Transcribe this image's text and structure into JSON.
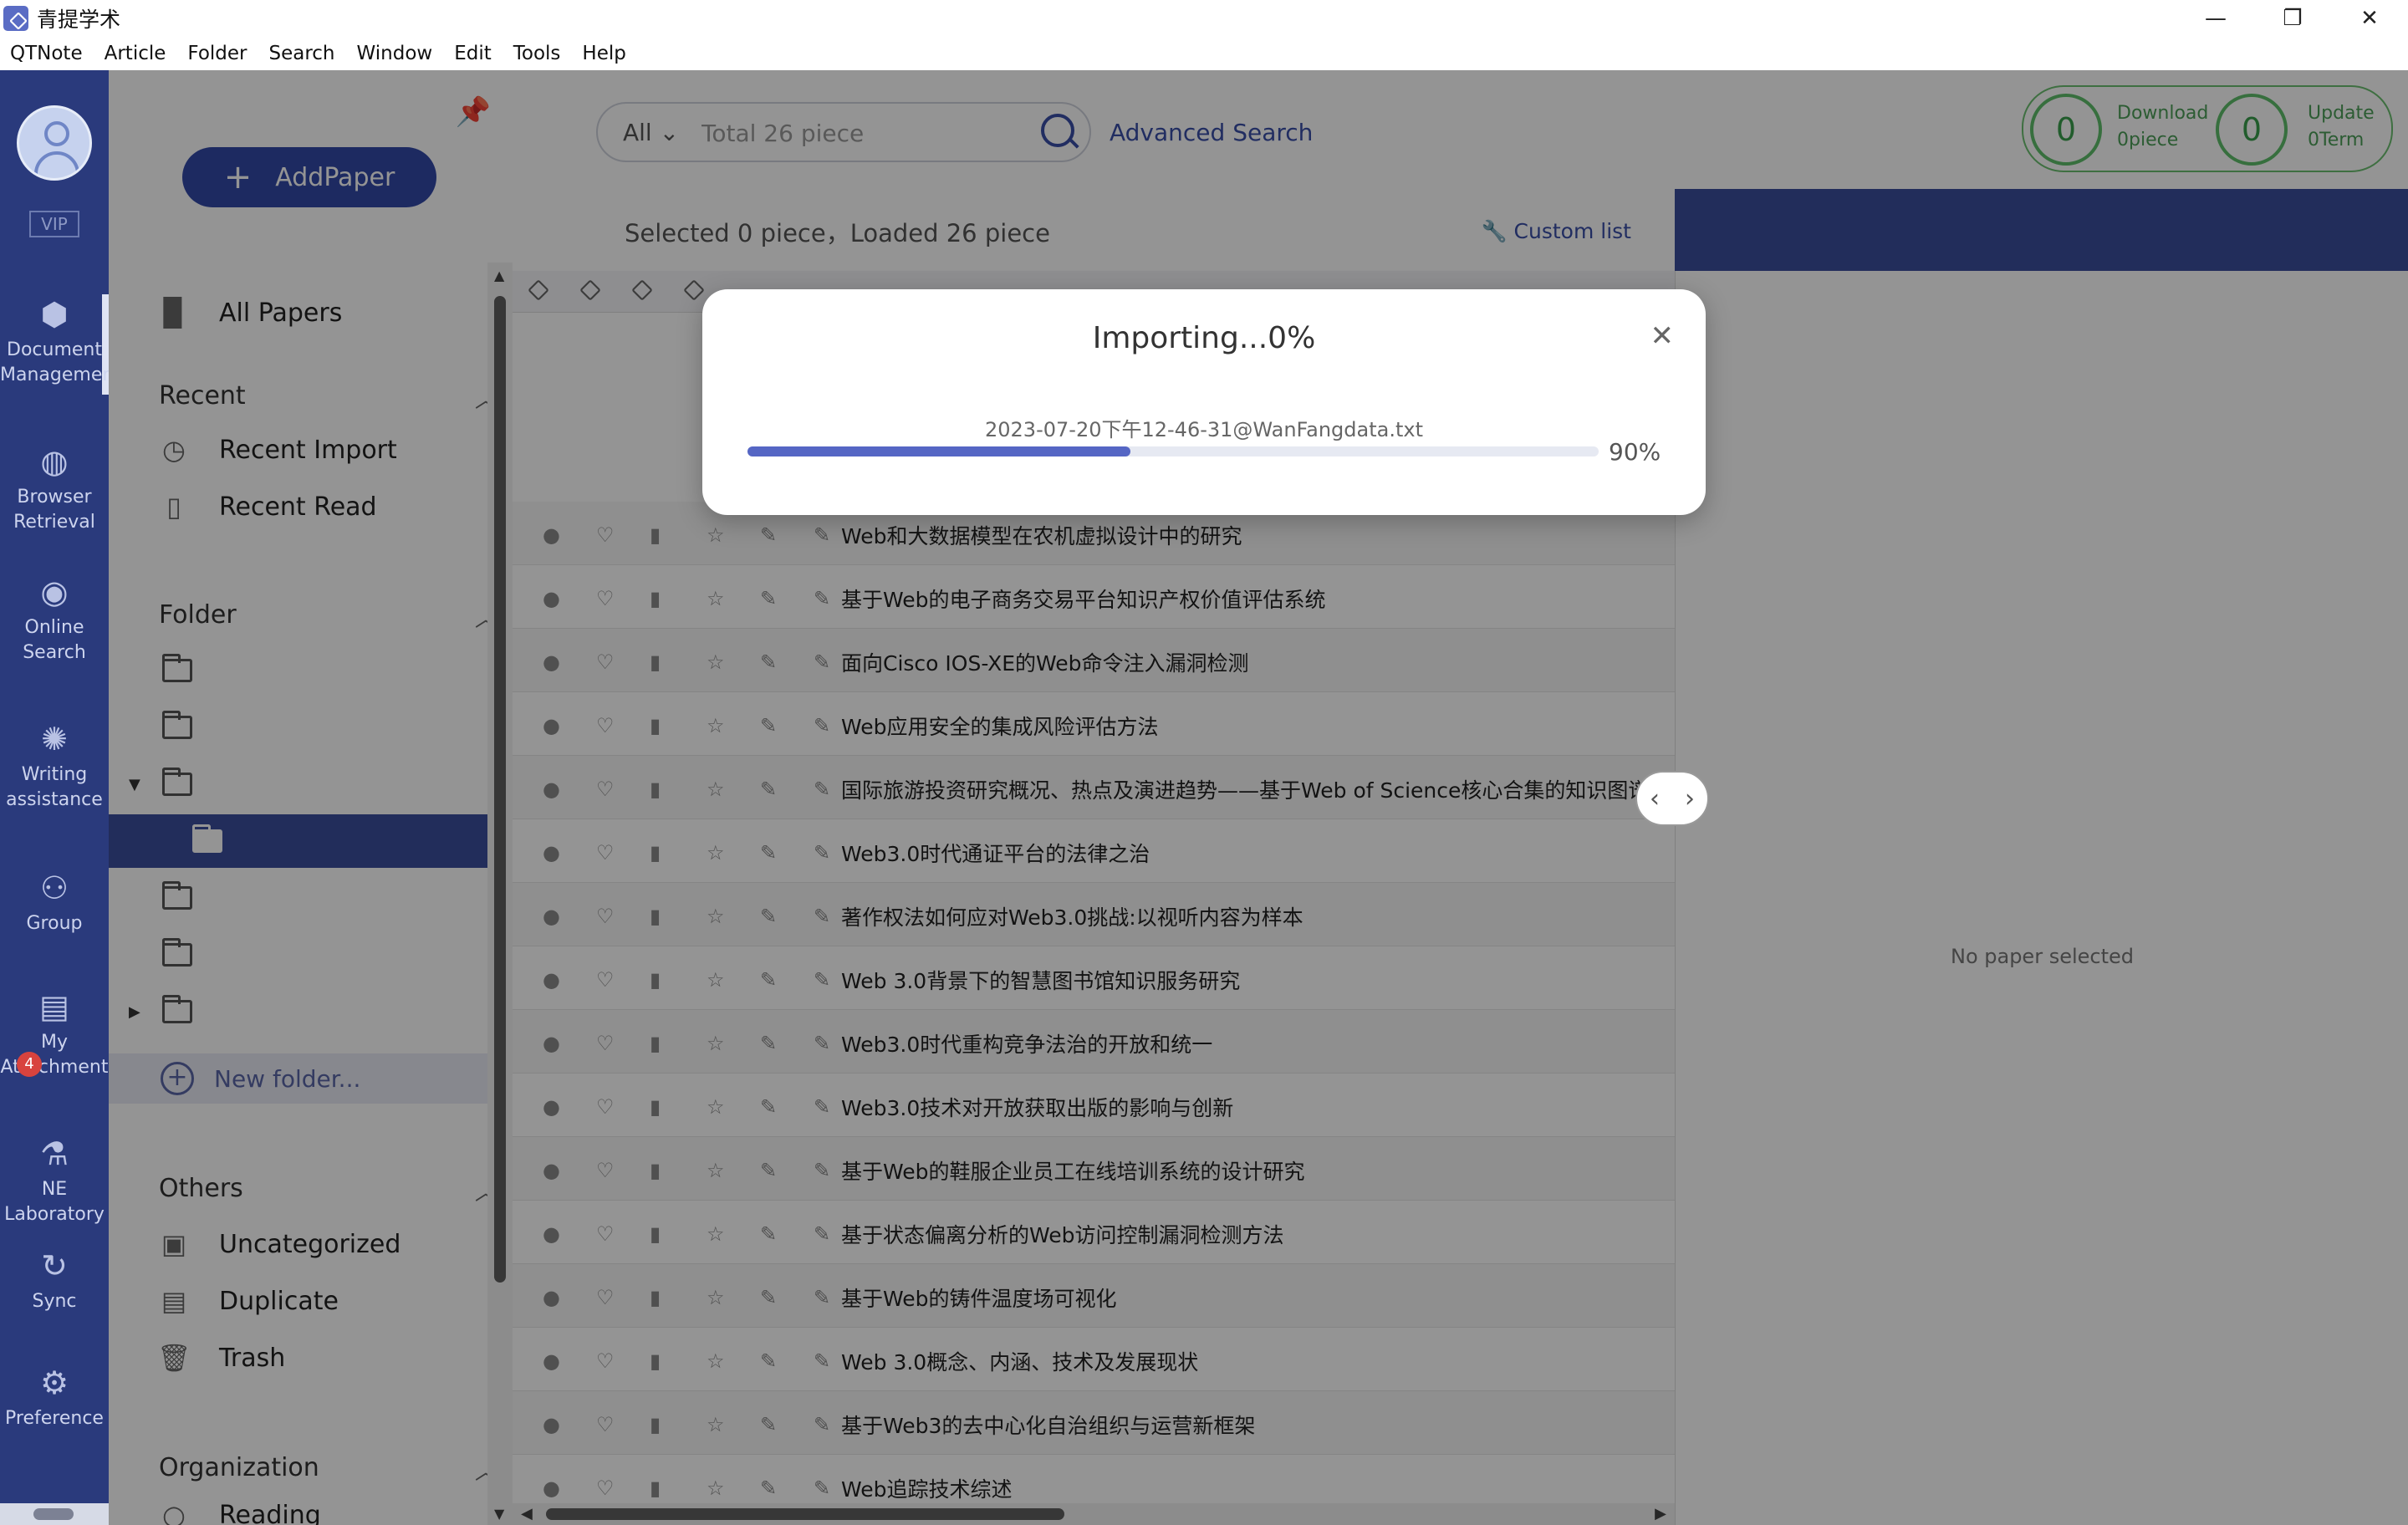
{
  "window": {
    "title": "青提学术",
    "controls": {
      "minimize": "—",
      "maximize": "❐",
      "close": "✕"
    }
  },
  "menu": [
    "QTNote",
    "Article",
    "Folder",
    "Search",
    "Window",
    "Edit",
    "Tools",
    "Help"
  ],
  "leftnav": {
    "vip": "VIP",
    "items": [
      {
        "label1": "Document",
        "label2": "Managemen",
        "icon": "cube-icon"
      },
      {
        "label1": "Browser",
        "label2": "Retrieval",
        "icon": "globe-icon"
      },
      {
        "label1": "Online",
        "label2": "Search",
        "icon": "eye-icon"
      },
      {
        "label1": "Writing",
        "label2": "assistance",
        "icon": "bulb-icon"
      },
      {
        "label1": "Group",
        "label2": "",
        "icon": "group-icon"
      },
      {
        "label1": "My",
        "label2": "Attachment",
        "icon": "attachment-icon"
      },
      {
        "label1": "NE",
        "label2": "Laboratory",
        "icon": "lab-icon"
      },
      {
        "label1": "Sync",
        "label2": "",
        "icon": "sync-icon"
      },
      {
        "label1": "Preference",
        "label2": "",
        "icon": "gear-icon"
      }
    ],
    "attachment_badge": "4"
  },
  "sidebar": {
    "add_paper": "AddPaper",
    "all_papers": "All Papers",
    "recent": {
      "title": "Recent",
      "items": [
        "Recent Import",
        "Recent Read"
      ]
    },
    "folder": {
      "title": "Folder",
      "new_folder": "New folder..."
    },
    "others": {
      "title": "Others",
      "items": [
        "Uncategorized",
        "Duplicate",
        "Trash"
      ]
    },
    "organization": {
      "title": "Organization",
      "items": [
        "Reading"
      ]
    }
  },
  "search": {
    "scope": "All",
    "placeholder": "Total 26 piece",
    "advanced": "Advanced Search"
  },
  "stats": {
    "download_count": "0",
    "download_label": "Download",
    "download_sub": "0piece",
    "update_count": "0",
    "update_label": "Update",
    "update_sub": "0Term"
  },
  "list": {
    "selected_info": "Selected 0 piece，Loaded 26 piece",
    "custom_list": "Custom list",
    "rows": [
      "Web和大数据模型在农机虚拟设计中的研究",
      "基于Web的电子商务交易平台知识产权价值评估系统",
      "面向Cisco IOS-XE的Web命令注入漏洞检测",
      "Web应用安全的集成风险评估方法",
      "国际旅游投资研究概况、热点及演进趋势——基于Web of Science核心合集的知识图谱分析",
      "Web3.0时代通证平台的法律之治",
      "著作权法如何应对Web3.0挑战:以视听内容为样本",
      "Web 3.0背景下的智慧图书馆知识服务研究",
      "Web3.0时代重构竞争法治的开放和统一",
      "Web3.0技术对开放获取出版的影响与创新",
      "基于Web的鞋服企业员工在线培训系统的设计研究",
      "基于状态偏离分析的Web访问控制漏洞检测方法",
      "基于Web的铸件温度场可视化",
      "Web 3.0概念、内涵、技术及发展现状",
      "基于Web3的去中心化自治组织与运营新框架",
      "Web追踪技术综述"
    ]
  },
  "detail": {
    "empty": "No paper selected"
  },
  "import_dialog": {
    "title": "Importing...0%",
    "file": "2023-07-20下午12-46-31@WanFangdata.txt",
    "percent_label": "90%",
    "progress": 0.45,
    "close": "✕"
  }
}
